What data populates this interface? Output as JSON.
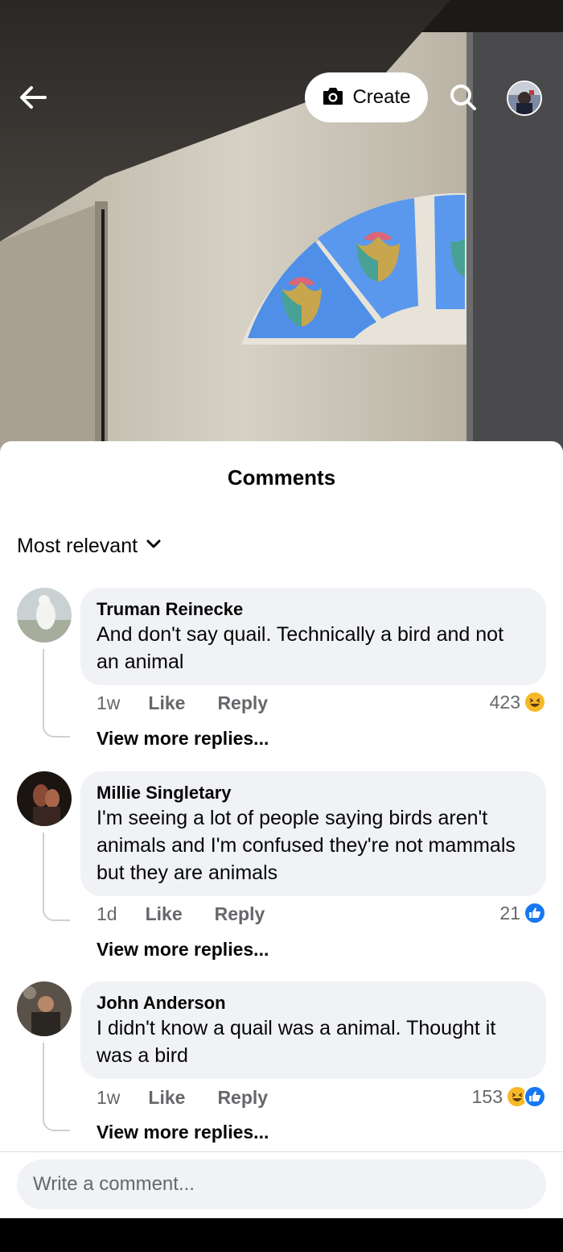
{
  "topbar": {
    "back_icon": "arrow-left-icon",
    "create_label": "Create",
    "create_icon": "camera-icon",
    "search_icon": "search-icon"
  },
  "sheet": {
    "title": "Comments",
    "sort_label": "Most relevant"
  },
  "comments": [
    {
      "author": "Truman Reinecke",
      "text": "And don't say quail. Technically a bird and not an animal",
      "time": "1w",
      "like": "Like",
      "reply": "Reply",
      "reaction_count": "423",
      "reactions": [
        "haha"
      ],
      "more_replies": "View more replies..."
    },
    {
      "author": "Millie Singletary",
      "text": "I'm seeing a lot of people saying birds aren't animals and I'm confused they're not mammals but they are animals",
      "time": "1d",
      "like": "Like",
      "reply": "Reply",
      "reaction_count": "21",
      "reactions": [
        "like"
      ],
      "more_replies": "View more replies..."
    },
    {
      "author": "John Anderson",
      "text": "I didn't know a quail was a animal. Thought it was a bird",
      "time": "1w",
      "like": "Like",
      "reply": "Reply",
      "reaction_count": "153",
      "reactions": [
        "haha",
        "like"
      ],
      "more_replies": "View more replies..."
    }
  ],
  "composer": {
    "placeholder": "Write a comment..."
  },
  "colors": {
    "like_blue": "#1877f2",
    "haha_yellow": "#f7b928",
    "bubble_bg": "#f0f2f5",
    "secondary_text": "#65676b"
  }
}
